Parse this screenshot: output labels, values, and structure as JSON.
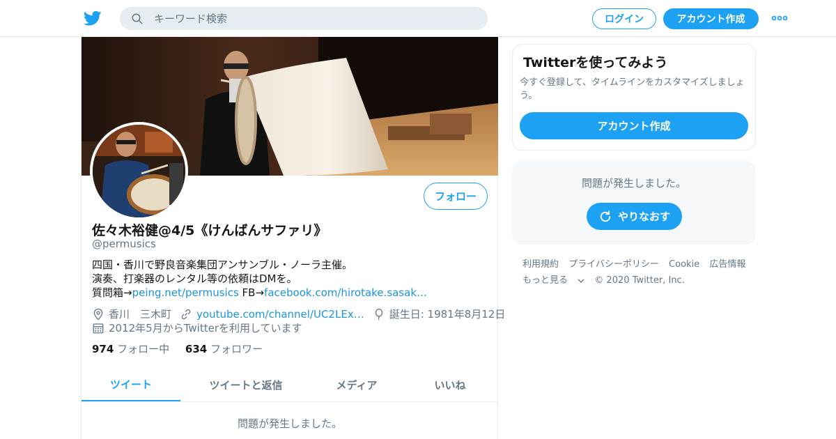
{
  "header": {
    "search_placeholder": "キーワード検索",
    "login_label": "ログイン",
    "signup_label": "アカウント作成"
  },
  "profile": {
    "follow_label": "フォロー",
    "name": "佐々木裕健@4/5《けんばんサファリ》",
    "handle": "@permusics",
    "bio": {
      "line1": "四国・香川で野良音楽集団アンサンブル・ノーラ主催。",
      "line2": "演奏、打楽器のレンタル等の依頼はDMを。",
      "line3_prefix": "質問箱→",
      "line3_link1": "peing.net/permusics",
      "line3_mid": " FB→",
      "line3_link2": "facebook.com/hirotake.sasak…"
    },
    "location": "香川　三木町",
    "url": "youtube.com/channel/UC2LEx…",
    "birthday": "誕生日: 1981年8月12日",
    "joined": "2012年5月からTwitterを利用しています",
    "following_count": "974",
    "following_label": "フォロー中",
    "followers_count": "634",
    "followers_label": "フォロワー"
  },
  "tabs": [
    {
      "label": "ツイート",
      "active": true
    },
    {
      "label": "ツイートと返信",
      "active": false
    },
    {
      "label": "メディア",
      "active": false
    },
    {
      "label": "いいね",
      "active": false
    }
  ],
  "main_error": "問題が発生しました。",
  "sidebar": {
    "title": "Twitterを使ってみよう",
    "desc": "今すぐ登録して、タイムラインをカスタマイズしましょう。",
    "cta": "アカウント作成",
    "error": "問題が発生しました。",
    "retry": "やりなおす"
  },
  "footer": {
    "terms": "利用規約",
    "privacy": "プライバシーポリシー",
    "cookie": "Cookie",
    "ads": "広告情報",
    "more": "もっと見る",
    "copyright": "© 2020 Twitter, Inc."
  },
  "colors": {
    "accent": "#1da1f2",
    "link": "#1b95e0",
    "muted": "#657786",
    "text": "#14171a",
    "border": "#e6ecf0"
  }
}
